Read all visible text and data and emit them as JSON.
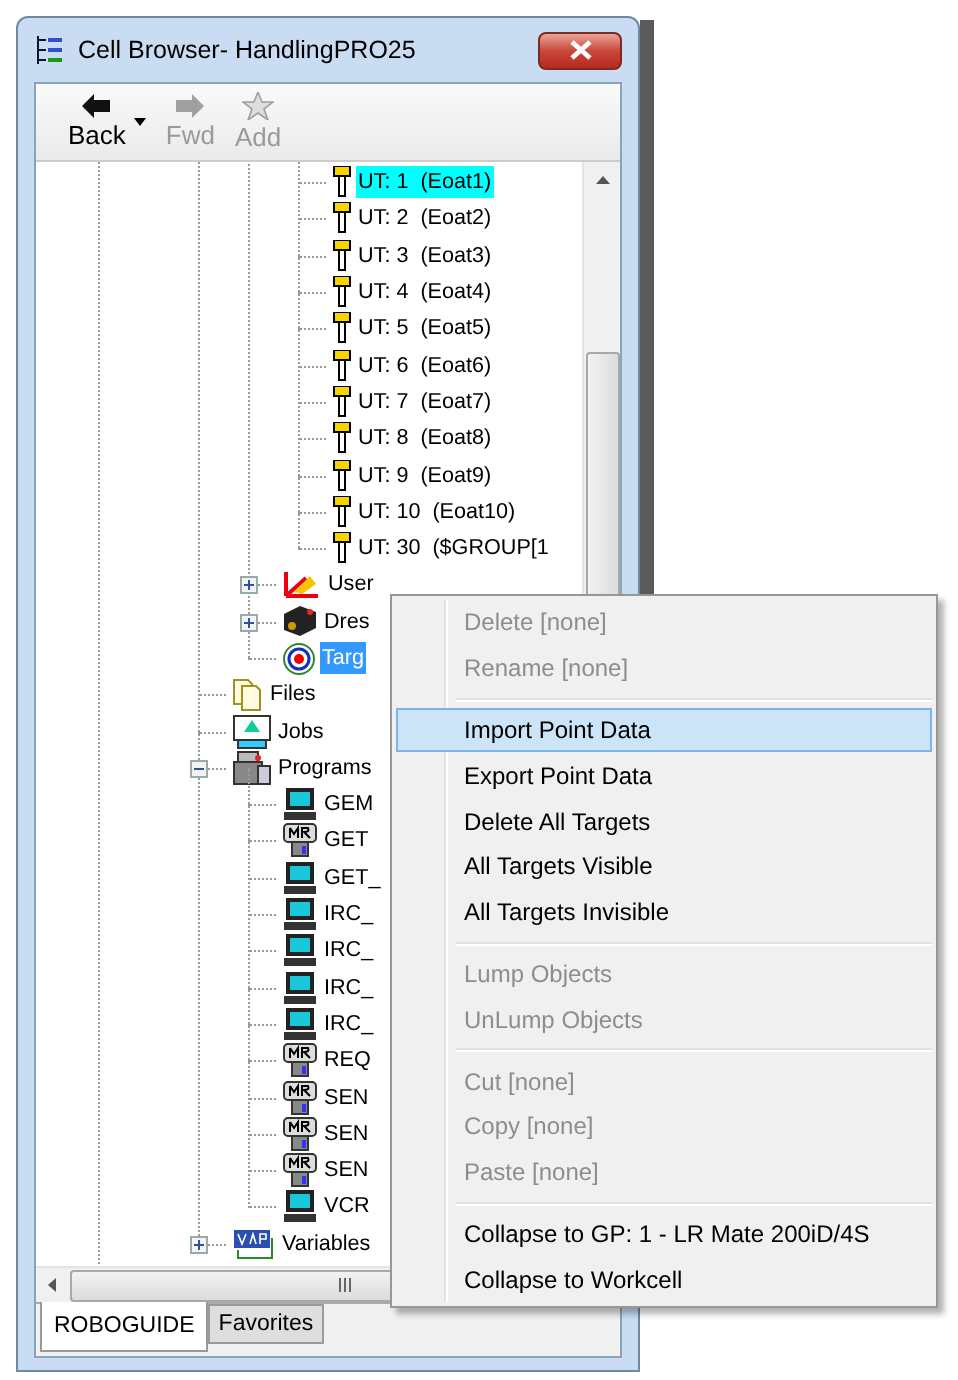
{
  "window": {
    "title": "Cell Browser- HandlingPRO25"
  },
  "toolbar": [
    {
      "label": "Back",
      "kind": "back",
      "disabled": false
    },
    {
      "label": "Fwd",
      "kind": "forward",
      "disabled": true
    },
    {
      "label": "Add",
      "kind": "add",
      "disabled": true
    }
  ],
  "tree": [
    {
      "children": [
        {
          "children": [
            {
              "label": "UT: 1  (Eoat1)",
              "kind": "tool",
              "selected": false,
              "active": true
            },
            {
              "label": "UT: 2  (Eoat2)",
              "kind": "tool",
              "selected": false,
              "active": false
            },
            {
              "label": "UT: 3  (Eoat3)",
              "kind": "tool",
              "selected": false,
              "active": false
            },
            {
              "label": "UT: 4  (Eoat4)",
              "kind": "tool",
              "selected": false,
              "active": false
            },
            {
              "label": "UT: 5  (Eoat5)",
              "kind": "tool",
              "selected": false,
              "active": false
            },
            {
              "label": "UT: 6  (Eoat6)",
              "kind": "tool",
              "selected": false,
              "active": false
            },
            {
              "label": "UT: 7  (Eoat7)",
              "kind": "tool",
              "selected": false,
              "active": false
            },
            {
              "label": "UT: 8  (Eoat8)",
              "kind": "tool",
              "selected": false,
              "active": false
            },
            {
              "label": "UT: 9  (Eoat9)",
              "kind": "tool",
              "selected": false,
              "active": false
            },
            {
              "label": "UT: 10  (Eoat10)",
              "kind": "tool",
              "selected": false,
              "active": false
            },
            {
              "label": "UT: 30  ($GROUP[1",
              "kind": "tool",
              "selected": false,
              "active": false
            }
          ]
        },
        {
          "label": "User",
          "kind": "userframes",
          "expanded": false,
          "selected": false
        },
        {
          "label": "Dres",
          "kind": "dress",
          "expanded": false,
          "selected": false
        },
        {
          "label": "Targ",
          "kind": "target",
          "selected": true
        }
      ]
    },
    {
      "label": "Files",
      "kind": "files",
      "selected": false
    },
    {
      "label": "Jobs",
      "kind": "jobs",
      "selected": false
    },
    {
      "label": "Programs",
      "kind": "programs",
      "expanded": true,
      "selected": false,
      "children": [
        {
          "label": "GEM",
          "kind": "pc",
          "selected": false
        },
        {
          "label": "GET",
          "kind": "mr",
          "selected": false
        },
        {
          "label": "GET_",
          "kind": "pc",
          "selected": false
        },
        {
          "label": "IRC_",
          "kind": "pc",
          "selected": false
        },
        {
          "label": "IRC_",
          "kind": "pc",
          "selected": false
        },
        {
          "label": "IRC_",
          "kind": "pc",
          "selected": false
        },
        {
          "label": "IRC_",
          "kind": "pc",
          "selected": false
        },
        {
          "label": "REQ",
          "kind": "mr",
          "selected": false
        },
        {
          "label": "SEN",
          "kind": "mr",
          "selected": false
        },
        {
          "label": "SEN",
          "kind": "mr",
          "selected": false
        },
        {
          "label": "SEN",
          "kind": "mr",
          "selected": false
        },
        {
          "label": "VCR",
          "kind": "pc",
          "selected": false
        }
      ]
    },
    {
      "label": "Variables",
      "kind": "variables",
      "expanded": false,
      "selected": false
    }
  ],
  "context_menu": [
    {
      "kind": "item",
      "label": "Delete [none]",
      "disabled": true,
      "selected": false
    },
    {
      "kind": "item",
      "label": "Rename [none]",
      "disabled": true,
      "selected": false
    },
    {
      "kind": "separator"
    },
    {
      "kind": "item",
      "label": "Import Point Data",
      "disabled": false,
      "selected": true
    },
    {
      "kind": "item",
      "label": "Export Point Data",
      "disabled": false,
      "selected": false
    },
    {
      "kind": "item",
      "label": "Delete All Targets",
      "disabled": false,
      "selected": false
    },
    {
      "kind": "item",
      "label": "All Targets Visible",
      "disabled": false,
      "selected": false
    },
    {
      "kind": "item",
      "label": "All Targets Invisible",
      "disabled": false,
      "selected": false
    },
    {
      "kind": "separator"
    },
    {
      "kind": "item",
      "label": "Lump Objects",
      "disabled": true,
      "selected": false
    },
    {
      "kind": "item",
      "label": "UnLump Objects",
      "disabled": true,
      "selected": false
    },
    {
      "kind": "separator"
    },
    {
      "kind": "item",
      "label": "Cut [none]",
      "disabled": true,
      "selected": false
    },
    {
      "kind": "item",
      "label": "Copy [none]",
      "disabled": true,
      "selected": false
    },
    {
      "kind": "item",
      "label": "Paste [none]",
      "disabled": true,
      "selected": false
    },
    {
      "kind": "separator"
    },
    {
      "kind": "item",
      "label": "Collapse to GP: 1 - LR Mate 200iD/4S",
      "disabled": false,
      "selected": false
    },
    {
      "kind": "item",
      "label": "Collapse to Workcell",
      "disabled": false,
      "selected": false
    }
  ],
  "tabs": [
    {
      "label": "ROBOGUIDE",
      "selected": true
    },
    {
      "label": "Favorites",
      "selected": false
    }
  ]
}
